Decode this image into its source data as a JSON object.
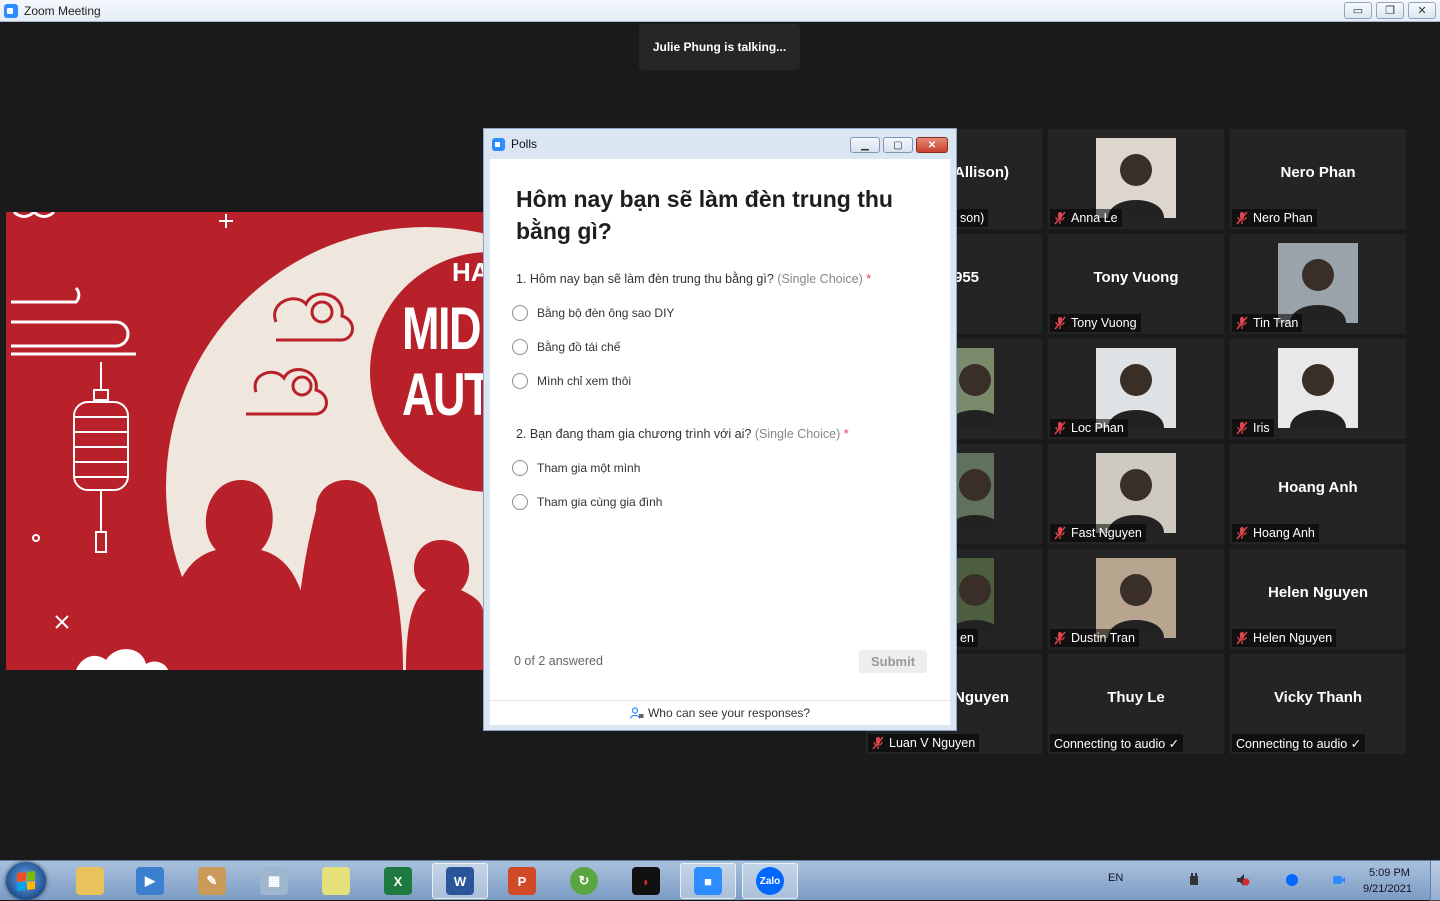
{
  "window": {
    "title": "Zoom Meeting",
    "minimize": "▭",
    "restore": "❐",
    "close": "✕"
  },
  "talking": "Julie Phung is talking...",
  "share": {
    "ha": "HA",
    "line1": "MID",
    "line2": "AUT"
  },
  "polls": {
    "title": "Polls",
    "heading": "Hôm nay bạn sẽ làm đèn trung thu bằng gì?",
    "questions": [
      {
        "text": "1. Hôm nay bạn sẽ làm đèn trung thu bằng gì?",
        "type": "(Single Choice)",
        "req": "*",
        "options": [
          "Bằng bộ đèn ông sao DIY",
          "Bằng đồ tái chế",
          "Mình chỉ xem thôi"
        ]
      },
      {
        "text": "2. Bạn đang tham gia chương trình với ai?",
        "type": "(Single Choice)",
        "req": "*",
        "options": [
          "Tham gia một mình",
          "Tham gia cùng gia đình"
        ]
      }
    ],
    "answered": "0 of 2 answered",
    "submit": "Submit",
    "who": "Who can see your responses?"
  },
  "participants": {
    "col1": [
      {
        "big": "Allison)",
        "label": "son)"
      },
      {
        "big": "955",
        "label": ""
      },
      {
        "big": "",
        "label": ""
      },
      {
        "big": "",
        "label": ""
      },
      {
        "big": "",
        "label": "en"
      },
      {
        "big": "Nguyen",
        "label": "Luan V Nguyen"
      }
    ],
    "col2": [
      {
        "big": "",
        "label": "Anna Le"
      },
      {
        "big": "Tony Vuong",
        "label": "Tony Vuong"
      },
      {
        "big": "",
        "label": "Loc Phan"
      },
      {
        "big": "",
        "label": "Fast Nguyen"
      },
      {
        "big": "",
        "label": "Dustin Tran"
      },
      {
        "big": "Thuy Le",
        "label": "Connecting to audio ✓"
      }
    ],
    "col3": [
      {
        "big": "Nero Phan",
        "label": "Nero Phan"
      },
      {
        "big": "",
        "label": "Tin Tran"
      },
      {
        "big": "",
        "label": "Iris"
      },
      {
        "big": "Hoang Anh",
        "label": "Hoang Anh"
      },
      {
        "big": "Helen Nguyen",
        "label": "Helen Nguyen"
      },
      {
        "big": "Vicky Thanh",
        "label": "Connecting to audio ✓"
      }
    ]
  },
  "taskbar": {
    "lang": "EN",
    "time": "5:09 PM",
    "date": "9/21/2021",
    "zalo": "Zalo",
    "word": "W",
    "excel": "X",
    "ppt": "P"
  },
  "colors": {
    "accent": "#2d8cff",
    "required": "#e0454d",
    "mute": "#e0454d",
    "share_red": "#b8202a"
  }
}
